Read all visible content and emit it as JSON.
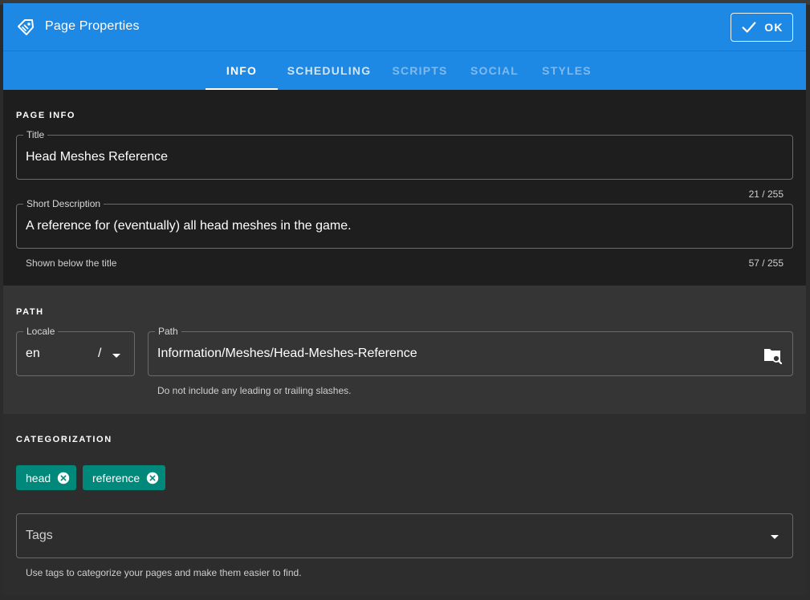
{
  "dialog": {
    "title": "Page Properties",
    "ok_label": "OK",
    "accent_color": "#1e88e5",
    "chip_color": "#00897b"
  },
  "tabs": [
    {
      "label": "INFO",
      "state": "active"
    },
    {
      "label": "SCHEDULING",
      "state": "normal"
    },
    {
      "label": "SCRIPTS",
      "state": "disabled"
    },
    {
      "label": "SOCIAL",
      "state": "disabled"
    },
    {
      "label": "STYLES",
      "state": "disabled"
    }
  ],
  "page_info": {
    "section_title": "PAGE INFO",
    "title_label": "Title",
    "title_value": "Head Meshes Reference",
    "title_counter": "21 / 255",
    "desc_label": "Short Description",
    "desc_value": "A reference for (eventually) all head meshes in the game.",
    "desc_hint": "Shown below the title",
    "desc_counter": "57 / 255"
  },
  "path": {
    "section_title": "PATH",
    "locale_label": "Locale",
    "locale_value": "en",
    "locale_separator": "/",
    "path_label": "Path",
    "path_value": "Information/Meshes/Head-Meshes-Reference",
    "path_hint": "Do not include any leading or trailing slashes."
  },
  "categorization": {
    "section_title": "CATEGORIZATION",
    "chips": [
      {
        "label": "head"
      },
      {
        "label": "reference"
      }
    ],
    "tags_placeholder": "Tags",
    "tags_hint": "Use tags to categorize your pages and make them easier to find."
  }
}
